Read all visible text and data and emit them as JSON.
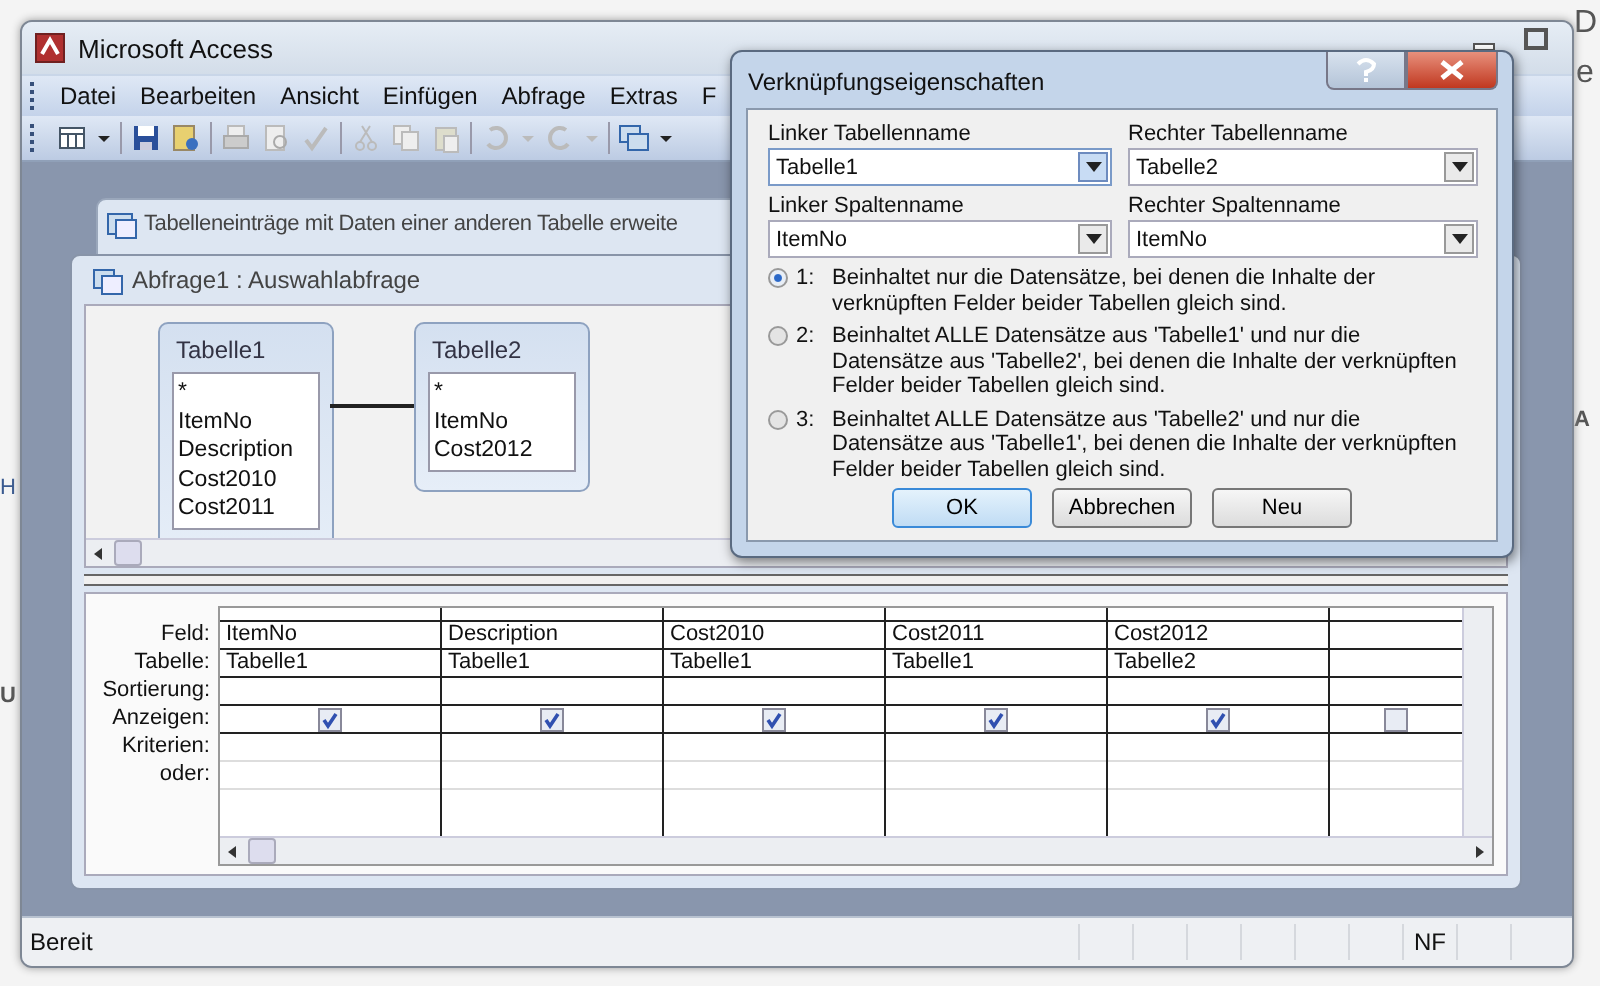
{
  "background": {
    "fragments": [
      {
        "kind": "right",
        "text": "D"
      },
      {
        "kind": "right",
        "text": "e"
      },
      {
        "kind": "right",
        "text": "A"
      },
      {
        "kind": "left",
        "text": "H"
      },
      {
        "kind": "left",
        "text": "U"
      }
    ]
  },
  "window": {
    "title": "Microsoft Access"
  },
  "menu": [
    "Datei",
    "Bearbeiten",
    "Ansicht",
    "Einfügen",
    "Abfrage",
    "Extras",
    "F"
  ],
  "back_document": {
    "title": "Tabelleneinträge mit Daten einer anderen Tabelle erweite"
  },
  "query": {
    "title": "Abfrage1 : Auswahlabfrage",
    "tables": [
      {
        "name": "Tabelle1",
        "fields": [
          "*",
          "ItemNo",
          "Description",
          "Cost2010",
          "Cost2011"
        ]
      },
      {
        "name": "Tabelle2",
        "fields": [
          "*",
          "ItemNo",
          "Cost2012"
        ]
      }
    ],
    "grid": {
      "row_labels": [
        "Feld:",
        "Tabelle:",
        "Sortierung:",
        "Anzeigen:",
        "Kriterien:",
        "oder:"
      ],
      "columns": [
        {
          "field": "ItemNo",
          "table": "Tabelle1",
          "show": true
        },
        {
          "field": "Description",
          "table": "Tabelle1",
          "show": true
        },
        {
          "field": "Cost2010",
          "table": "Tabelle1",
          "show": true
        },
        {
          "field": "Cost2011",
          "table": "Tabelle1",
          "show": true
        },
        {
          "field": "Cost2012",
          "table": "Tabelle2",
          "show": true
        },
        {
          "show": false
        }
      ]
    }
  },
  "dialog": {
    "title": "Verknüpfungseigenschaften",
    "fields": [
      {
        "label": "Linker Tabellenname",
        "value": "Tabelle1",
        "focused": true
      },
      {
        "label": "Rechter Tabellenname",
        "value": "Tabelle2",
        "focused": false
      },
      {
        "label": "Linker Spaltenname",
        "value": "ItemNo",
        "focused": false
      },
      {
        "label": "Rechter Spaltenname",
        "value": "ItemNo",
        "focused": false
      }
    ],
    "options": [
      {
        "number": "1:",
        "text": "Beinhaltet nur die Datensätze, bei denen die Inhalte der verknüpften Felder beider Tabellen gleich sind.",
        "selected": true
      },
      {
        "number": "2:",
        "text": "Beinhaltet ALLE Datensätze aus 'Tabelle1' und nur die Datensätze aus 'Tabelle2', bei denen die Inhalte der verknüpften Felder beider Tabellen gleich sind.",
        "selected": false
      },
      {
        "number": "3:",
        "text": "Beinhaltet ALLE Datensätze aus 'Tabelle2' und nur die Datensätze aus 'Tabelle1', bei denen die Inhalte der verknüpften Felder beider Tabellen gleich sind.",
        "selected": false
      }
    ],
    "buttons": [
      {
        "label": "OK",
        "default": true
      },
      {
        "label": "Abbrechen",
        "default": false
      },
      {
        "label": "Neu",
        "default": false
      }
    ]
  },
  "status_bar": {
    "text": "Bereit",
    "indicators": [
      "NF"
    ]
  }
}
